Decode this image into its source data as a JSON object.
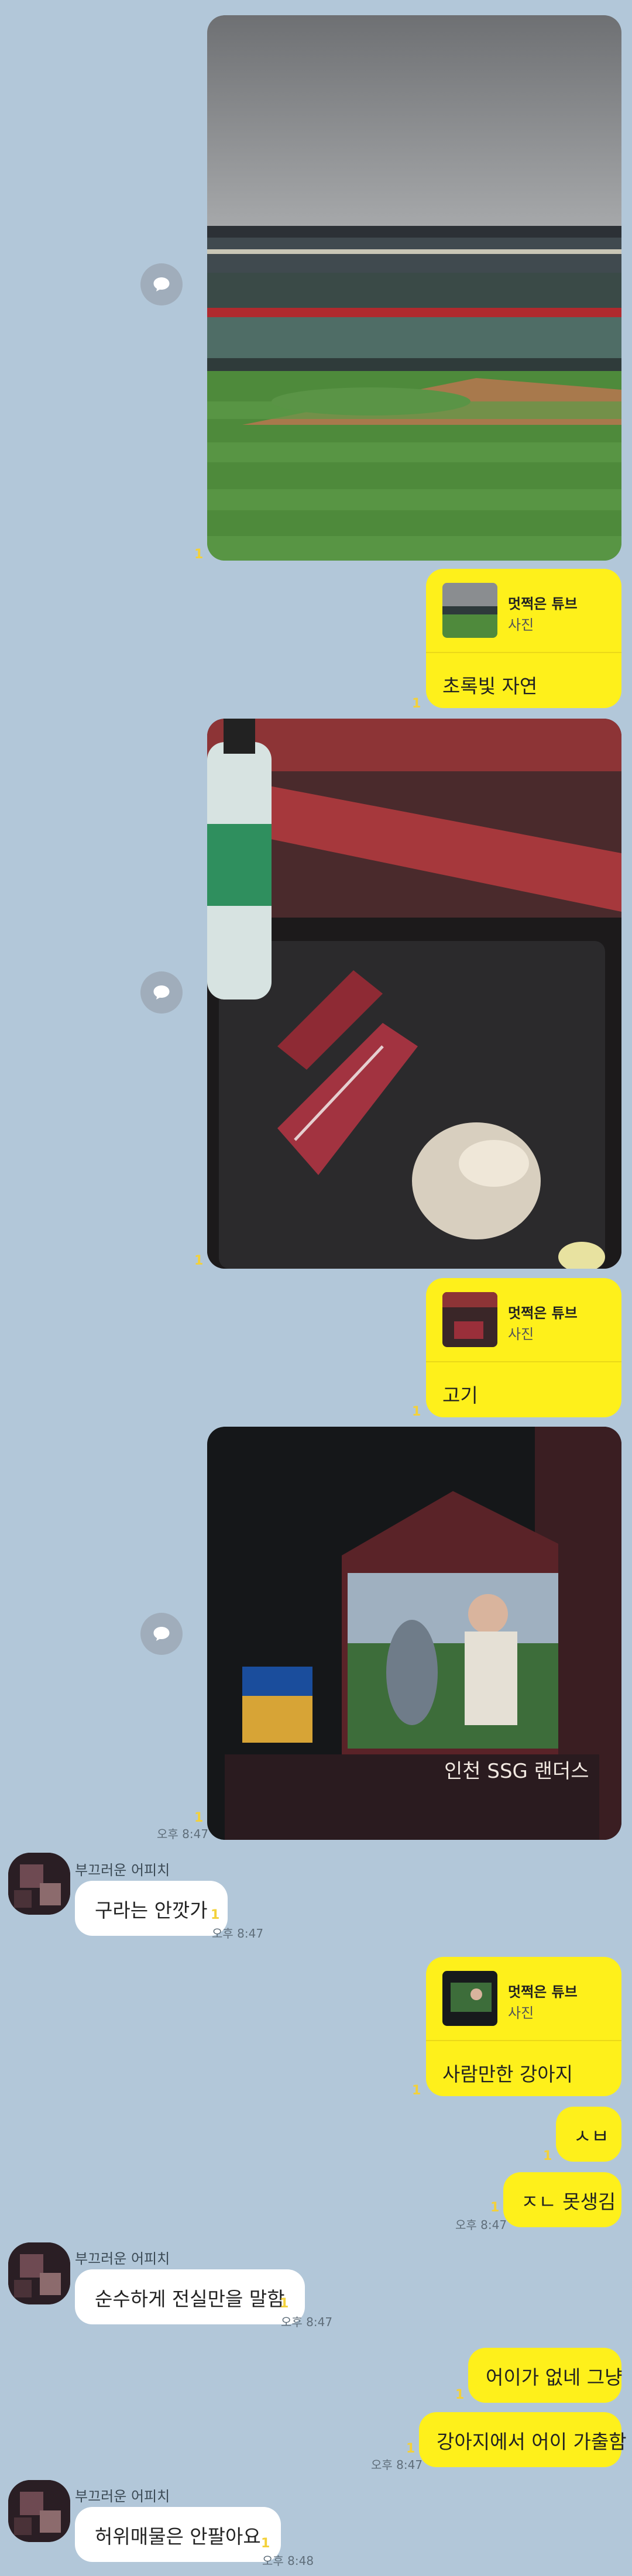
{
  "share_card_title": "멋쩍은 튜브",
  "share_card_type": "사진",
  "sender_name": "부끄러운 어피치",
  "unread_mark": "1",
  "messages": {
    "card1_caption": "초록빛 자연",
    "card2_caption": "고기",
    "photo3_time": "오후 8:47",
    "recv1_text": "구라는 안깟가",
    "recv1_time": "오후 8:47",
    "card3_caption": "사람만한 강아지",
    "sent1_text": "ㅅㅂ",
    "sent2_text": "ㅈㄴ 못생김",
    "sent2_time": "오후 8:47",
    "recv2_text": "순수하게 전실만을 말함",
    "recv2_time": "오후 8:47",
    "sent3_text": "어이가 없네 그냥",
    "sent4_text": "강아지에서 어이 가출함",
    "sent4_time": "오후 8:47",
    "recv3_text": "허위매물은 안팔아요",
    "recv3_time": "오후 8:48"
  },
  "photos": {
    "photo1_subject": "baseball stadium under cloudy sky",
    "photo2_subject": "raw beef and meat on a grill tray",
    "photo3_subject": "night stadium scoreboard with mascot",
    "scoreboard_text": "인천 SSG 랜더스"
  },
  "colors": {
    "background": "#b2c7d9",
    "sent_bubble": "#fef01b",
    "received_bubble": "#ffffff",
    "unread": "#f3d13a"
  }
}
